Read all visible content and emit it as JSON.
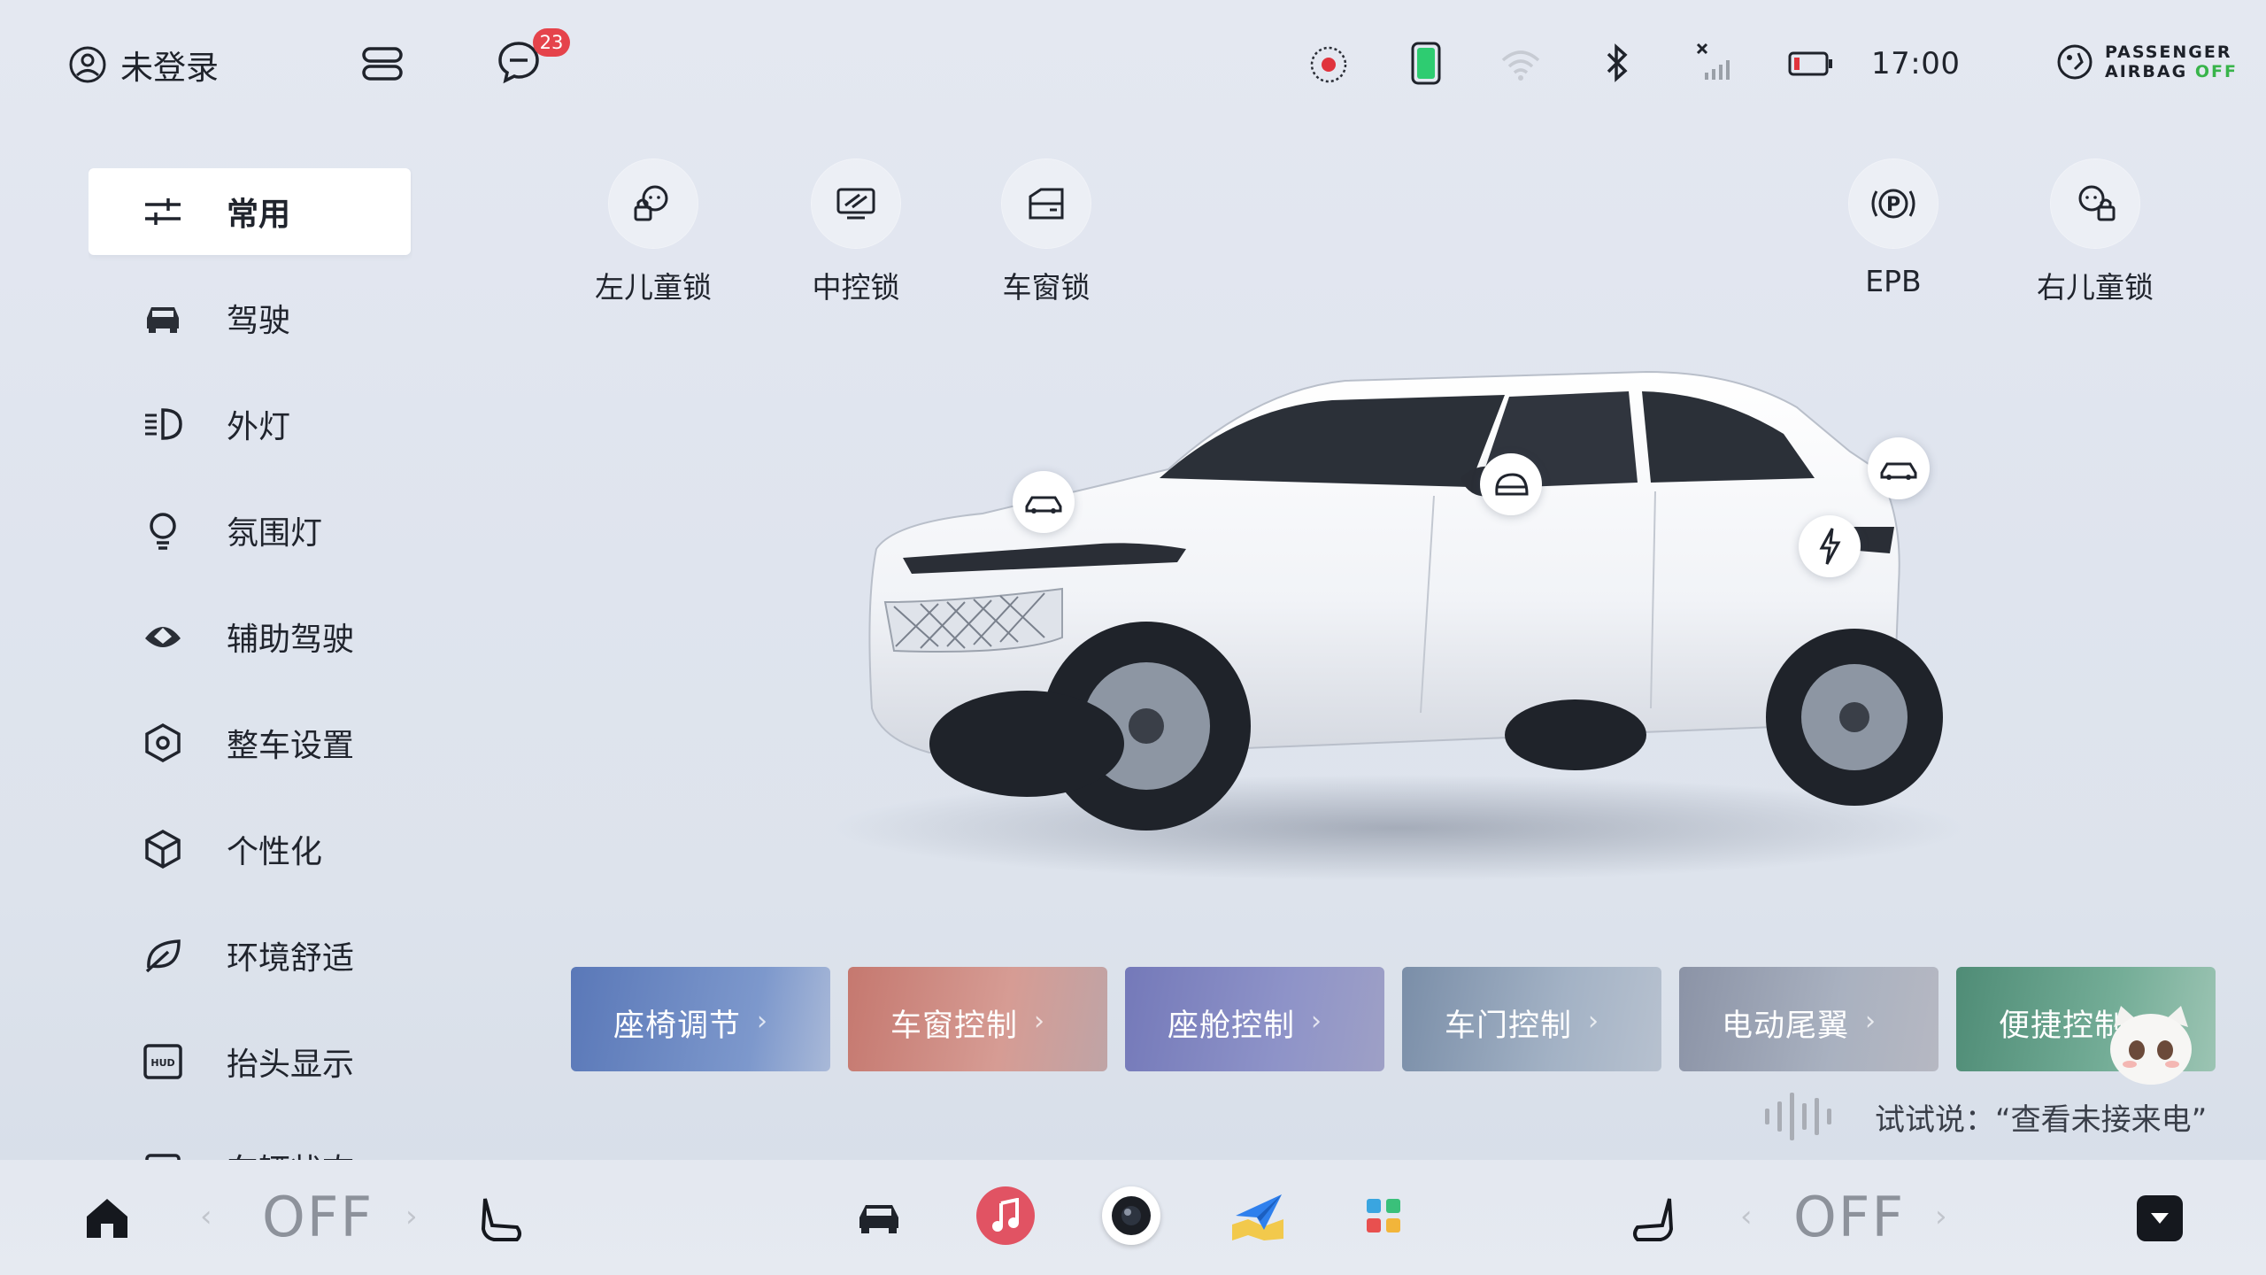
{
  "status_bar": {
    "user_label": "未登录",
    "message_count": "23",
    "time": "17:00",
    "airbag_line1": "PASSENGER",
    "airbag_line2": "AIRBAG",
    "airbag_state": "OFF"
  },
  "sidebar": {
    "items": [
      {
        "label": "常用",
        "icon": "sliders-icon",
        "active": true
      },
      {
        "label": "驾驶",
        "icon": "car-front-icon"
      },
      {
        "label": "外灯",
        "icon": "headlight-icon"
      },
      {
        "label": "氛围灯",
        "icon": "bulb-icon"
      },
      {
        "label": "辅助驾驶",
        "icon": "steering-wheel-icon"
      },
      {
        "label": "整车设置",
        "icon": "hexagon-settings-icon"
      },
      {
        "label": "个性化",
        "icon": "cube-icon"
      },
      {
        "label": "环境舒适",
        "icon": "leaf-icon"
      },
      {
        "label": "抬头显示",
        "icon": "hud-icon",
        "icon_text": "HUD"
      },
      {
        "label": "车辆状态",
        "icon": "vehicle-status-icon"
      }
    ]
  },
  "quick_controls": [
    {
      "label": "左儿童锁",
      "icon": "child-lock-left-icon"
    },
    {
      "label": "中控锁",
      "icon": "central-lock-icon"
    },
    {
      "label": "车窗锁",
      "icon": "window-lock-icon"
    },
    {
      "label": "EPB",
      "icon": "parking-brake-icon"
    },
    {
      "label": "右儿童锁",
      "icon": "child-lock-right-icon"
    }
  ],
  "car_hotspots": [
    "front-hood-icon",
    "mirror-icon",
    "rear-hatch-icon",
    "charge-port-icon"
  ],
  "cards": [
    {
      "label": "座椅调节"
    },
    {
      "label": "车窗控制"
    },
    {
      "label": "座舱控制"
    },
    {
      "label": "车门控制"
    },
    {
      "label": "电动尾翼"
    },
    {
      "label": "便捷控制"
    }
  ],
  "voice": {
    "hint": "试试说：“查看未接来电”"
  },
  "dock": {
    "left_temp": "OFF",
    "right_temp": "OFF",
    "apps": [
      "car-icon",
      "music-icon",
      "camera-icon",
      "navigation-icon",
      "apps-grid-icon"
    ]
  },
  "colors": {
    "badge": "#e5434b",
    "airbag_off": "#38b44a",
    "battery_green": "#2ecc71",
    "music_app": "#e15363"
  }
}
